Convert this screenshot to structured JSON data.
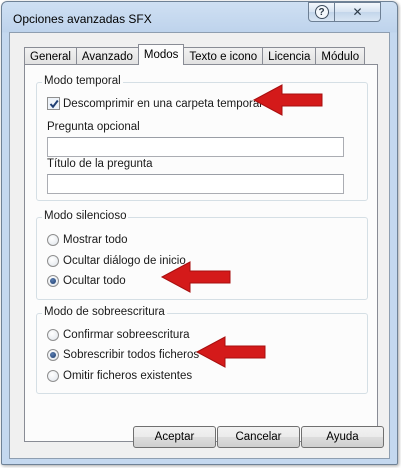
{
  "window": {
    "title": "Opciones avanzadas SFX",
    "help_glyph": "?",
    "close_glyph": "✕"
  },
  "tabs": [
    {
      "label": "General",
      "active": false
    },
    {
      "label": "Avanzado",
      "active": false
    },
    {
      "label": "Modos",
      "active": true
    },
    {
      "label": "Texto e icono",
      "active": false
    },
    {
      "label": "Licencia",
      "active": false
    },
    {
      "label": "Módulo",
      "active": false
    }
  ],
  "temp_mode": {
    "legend": "Modo temporal",
    "checkbox_label": "Descomprimir en una carpeta temporal",
    "checked": true,
    "optional_question_label": "Pregunta opcional",
    "optional_question_value": "",
    "question_title_label": "Título de la pregunta",
    "question_title_value": ""
  },
  "silent_mode": {
    "legend": "Modo silencioso",
    "options": [
      {
        "label": "Mostrar todo",
        "selected": false
      },
      {
        "label": "Ocultar diálogo de inicio",
        "selected": false
      },
      {
        "label": "Ocultar todo",
        "selected": true
      }
    ]
  },
  "overwrite_mode": {
    "legend": "Modo de sobreescritura",
    "options": [
      {
        "label": "Confirmar sobreescritura",
        "selected": false
      },
      {
        "label": "Sobrescribir todos ficheros",
        "selected": true
      },
      {
        "label": "Omitir ficheros existentes",
        "selected": false
      }
    ]
  },
  "buttons": {
    "accept": "Aceptar",
    "cancel": "Cancelar",
    "help": "Ayuda"
  },
  "colors": {
    "annotation_arrow": "#d41a1a",
    "checkmark": "#1f3f74"
  },
  "icons": {
    "help": "question-mark-icon",
    "close": "close-icon",
    "check": "checkmark-icon",
    "annotation": "red-arrow-icon"
  }
}
